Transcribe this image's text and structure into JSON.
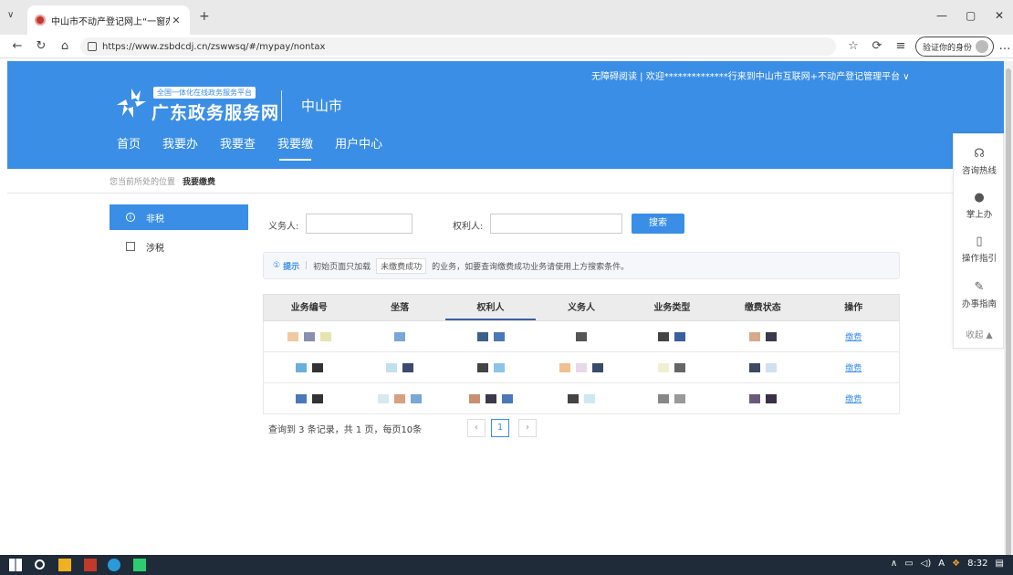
{
  "browser": {
    "tab_title": "中山市不动产登记网上“一窗办事”",
    "url": "https://www.zsbdcdj.cn/zswwsq/#/mypay/nontax",
    "verify_label": "验证你的身份"
  },
  "header": {
    "top_info": "无障碍阅读 | 欢迎**************行来到中山市互联网+不动产登记管理平台 ∨",
    "logo_sub": "全国一体化在线政务服务平台",
    "logo_main": "广东政务服务网",
    "city": "中山市",
    "nav": [
      "首页",
      "我要办",
      "我要查",
      "我要缴",
      "用户中心"
    ],
    "nav_active": "我要缴"
  },
  "breadcrumb": {
    "prefix": "您当前所处的位置",
    "current": "我要缴费"
  },
  "sidebar": {
    "items": [
      {
        "label": "非税"
      },
      {
        "label": "涉税"
      }
    ]
  },
  "search": {
    "obligor_label": "义务人:",
    "right_holder_label": "权利人:",
    "button": "搜索"
  },
  "tip": {
    "icon": "①",
    "head": "提示",
    "sep": "|",
    "text1": "初始页面只加载",
    "tag": "未缴费成功",
    "text2": "的业务，如要查询缴费成功业务请使用上方搜索条件。"
  },
  "table": {
    "headers": [
      "业务编号",
      "坐落",
      "权利人",
      "义务人",
      "业务类型",
      "缴费状态",
      "操作"
    ],
    "rows": [
      {
        "action": "缴费"
      },
      {
        "action": "缴费"
      },
      {
        "action": "缴费"
      }
    ]
  },
  "pagination": {
    "summary": "查询到 3 条记录，共 1 页，每页10条",
    "prev": "‹",
    "current": "1",
    "next": "›"
  },
  "right_panel": {
    "items": [
      "咨询热线",
      "掌上办",
      "操作指引",
      "办事指南"
    ],
    "collapse": "收起 ▲"
  },
  "taskbar": {
    "time": "8:32",
    "ime": "A"
  },
  "colors": {
    "primary": "#3a8ee6"
  }
}
